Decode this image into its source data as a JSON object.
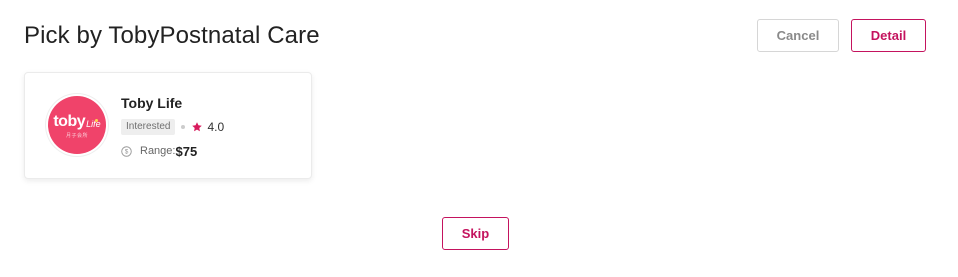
{
  "header": {
    "title": "Pick by TobyPostnatal Care",
    "cancel_label": "Cancel",
    "detail_label": "Detail"
  },
  "card": {
    "logo": {
      "text": "toby",
      "sub": "Life",
      "tagline": "月子会所",
      "color": "#f0436a"
    },
    "name": "Toby Life",
    "badge": "Interested",
    "rating": "4.0",
    "range_label": "Range:",
    "range_value": "$75",
    "icons": [
      "star-icon",
      "coin-icon"
    ]
  },
  "footer": {
    "skip_label": "Skip"
  },
  "colors": {
    "accent": "#c4135e",
    "star": "#d81b5d",
    "muted_border": "#d6d6d6"
  }
}
